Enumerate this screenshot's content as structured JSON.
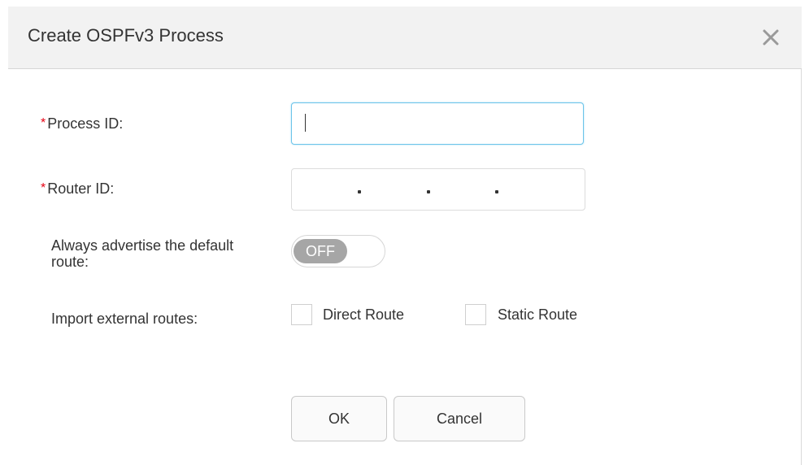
{
  "dialog": {
    "title": "Create OSPFv3 Process",
    "close_icon": "close-icon"
  },
  "form": {
    "process_id": {
      "required_mark": "*",
      "label": "Process ID:",
      "value": ""
    },
    "router_id": {
      "required_mark": "*",
      "label": "Router ID:",
      "separator": ".",
      "octets": [
        "",
        "",
        "",
        ""
      ]
    },
    "default_route": {
      "label": "Always advertise the default route:",
      "toggle_state": "OFF"
    },
    "external_routes": {
      "label": "Import external routes:",
      "options": [
        {
          "label": "Direct Route",
          "checked": false
        },
        {
          "label": "Static Route",
          "checked": false
        }
      ]
    }
  },
  "actions": {
    "ok_label": "OK",
    "cancel_label": "Cancel"
  }
}
